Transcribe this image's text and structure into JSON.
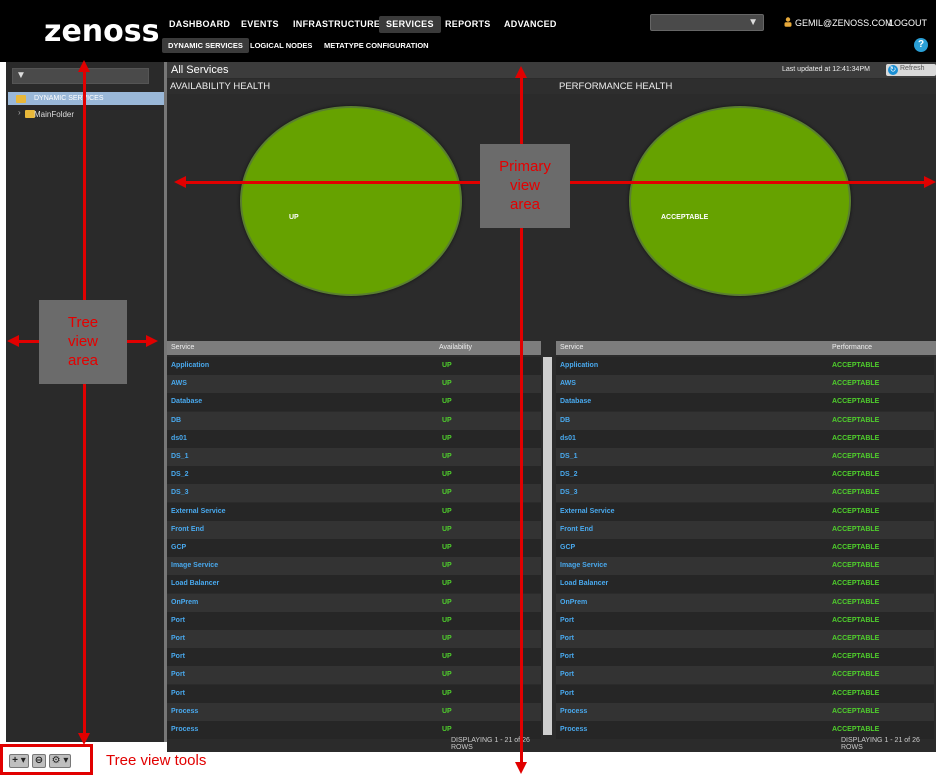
{
  "app": {
    "logo": "zenoss"
  },
  "nav": {
    "main": [
      "DASHBOARD",
      "EVENTS",
      "INFRASTRUCTURE",
      "SERVICES",
      "REPORTS",
      "ADVANCED"
    ],
    "active": "SERVICES",
    "sub": [
      "DYNAMIC SERVICES",
      "LOGICAL NODES",
      "METATYPE CONFIGURATION"
    ]
  },
  "user": {
    "email": "GEMIL@ZENOSS.COM",
    "logout": "LOGOUT",
    "help": "?"
  },
  "tree": {
    "filter_icon": "▼",
    "items": [
      {
        "label": "DYNAMIC SERVICES",
        "selected": true
      },
      {
        "label": "MainFolder",
        "selected": false
      }
    ],
    "tools": [
      "+ ▾",
      "⊖",
      "⚙ ▾"
    ]
  },
  "main": {
    "title": "All Services",
    "last_updated": "Last updated at 12:41:34PM",
    "refresh": "Refresh",
    "availability_title": "AVAILABILITY HEALTH",
    "performance_title": "PERFORMANCE HEALTH",
    "availability_pie_label": "UP",
    "performance_pie_label": "ACCEPTABLE",
    "colors": {
      "up": "#66a200",
      "link": "#49a9ee",
      "status": "#4fcf2c"
    }
  },
  "availability_table": {
    "headers": [
      "Service",
      "Availability"
    ],
    "rows": [
      {
        "service": "Application",
        "value": "UP"
      },
      {
        "service": "AWS",
        "value": "UP"
      },
      {
        "service": "Database",
        "value": "UP"
      },
      {
        "service": "DB",
        "value": "UP"
      },
      {
        "service": "ds01",
        "value": "UP"
      },
      {
        "service": "DS_1",
        "value": "UP"
      },
      {
        "service": "DS_2",
        "value": "UP"
      },
      {
        "service": "DS_3",
        "value": "UP"
      },
      {
        "service": "External Service",
        "value": "UP"
      },
      {
        "service": "Front End",
        "value": "UP"
      },
      {
        "service": "GCP",
        "value": "UP"
      },
      {
        "service": "Image Service",
        "value": "UP"
      },
      {
        "service": "Load Balancer",
        "value": "UP"
      },
      {
        "service": "OnPrem",
        "value": "UP"
      },
      {
        "service": "Port",
        "value": "UP"
      },
      {
        "service": "Port",
        "value": "UP"
      },
      {
        "service": "Port",
        "value": "UP"
      },
      {
        "service": "Port",
        "value": "UP"
      },
      {
        "service": "Port",
        "value": "UP"
      },
      {
        "service": "Process",
        "value": "UP"
      },
      {
        "service": "Process",
        "value": "UP"
      }
    ],
    "footer": "DISPLAYING 1 - 21 of 26 ROWS"
  },
  "performance_table": {
    "headers": [
      "Service",
      "Performance"
    ],
    "rows": [
      {
        "service": "Application",
        "value": "ACCEPTABLE"
      },
      {
        "service": "AWS",
        "value": "ACCEPTABLE"
      },
      {
        "service": "Database",
        "value": "ACCEPTABLE"
      },
      {
        "service": "DB",
        "value": "ACCEPTABLE"
      },
      {
        "service": "ds01",
        "value": "ACCEPTABLE"
      },
      {
        "service": "DS_1",
        "value": "ACCEPTABLE"
      },
      {
        "service": "DS_2",
        "value": "ACCEPTABLE"
      },
      {
        "service": "DS_3",
        "value": "ACCEPTABLE"
      },
      {
        "service": "External Service",
        "value": "ACCEPTABLE"
      },
      {
        "service": "Front End",
        "value": "ACCEPTABLE"
      },
      {
        "service": "GCP",
        "value": "ACCEPTABLE"
      },
      {
        "service": "Image Service",
        "value": "ACCEPTABLE"
      },
      {
        "service": "Load Balancer",
        "value": "ACCEPTABLE"
      },
      {
        "service": "OnPrem",
        "value": "ACCEPTABLE"
      },
      {
        "service": "Port",
        "value": "ACCEPTABLE"
      },
      {
        "service": "Port",
        "value": "ACCEPTABLE"
      },
      {
        "service": "Port",
        "value": "ACCEPTABLE"
      },
      {
        "service": "Port",
        "value": "ACCEPTABLE"
      },
      {
        "service": "Port",
        "value": "ACCEPTABLE"
      },
      {
        "service": "Process",
        "value": "ACCEPTABLE"
      },
      {
        "service": "Process",
        "value": "ACCEPTABLE"
      }
    ],
    "footer": "DISPLAYING 1 - 21 of 26 ROWS"
  },
  "annotations": {
    "tree_view_area": [
      "Tree",
      "view",
      "area"
    ],
    "primary_view_area": [
      "Primary",
      "view",
      "area"
    ],
    "tree_view_tools": "Tree view tools"
  }
}
